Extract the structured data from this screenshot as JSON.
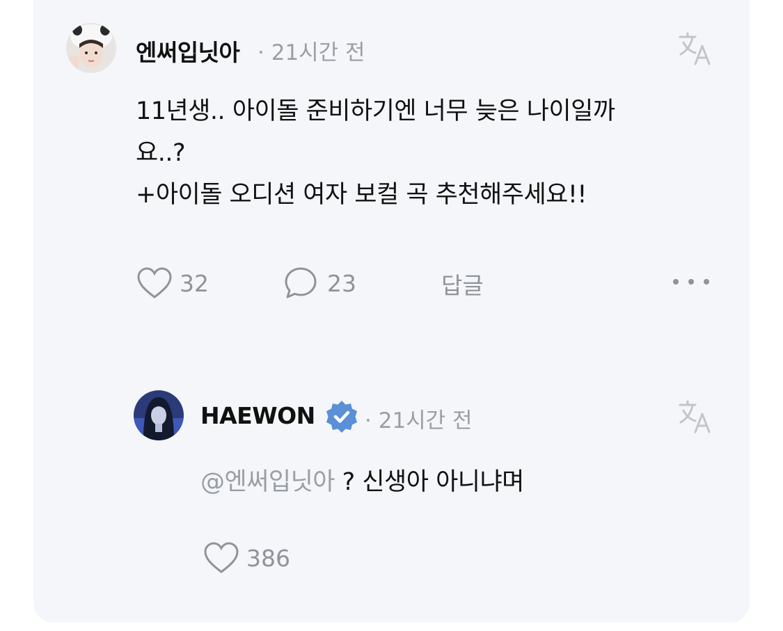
{
  "comment": {
    "username": "엔써입닛아",
    "time": "21시간 전",
    "body_line1": "11년생.. 아이돌 준비하기엔 너무 늦은 나이일까",
    "body_line2": "요..?",
    "body_line3": "+아이돌 오디션 여자 보컬 곡 추천해주세요!!",
    "likes": "32",
    "replies": "23",
    "reply_label": "답글",
    "more_icon": "more-horizontal-icon",
    "translate_icon": "translate-icon"
  },
  "reply": {
    "username": "HAEWON",
    "verified_icon": "verified-badge-icon",
    "time": "21시간 전",
    "mention": "@엔써입닛아",
    "text": " ? 신생아 아니냐며",
    "likes": "386",
    "translate_icon": "translate-icon"
  },
  "colors": {
    "card_bg": "#f4f6f9",
    "muted_text": "#9a9ea5",
    "verified_badge": "#5b8fd6"
  }
}
